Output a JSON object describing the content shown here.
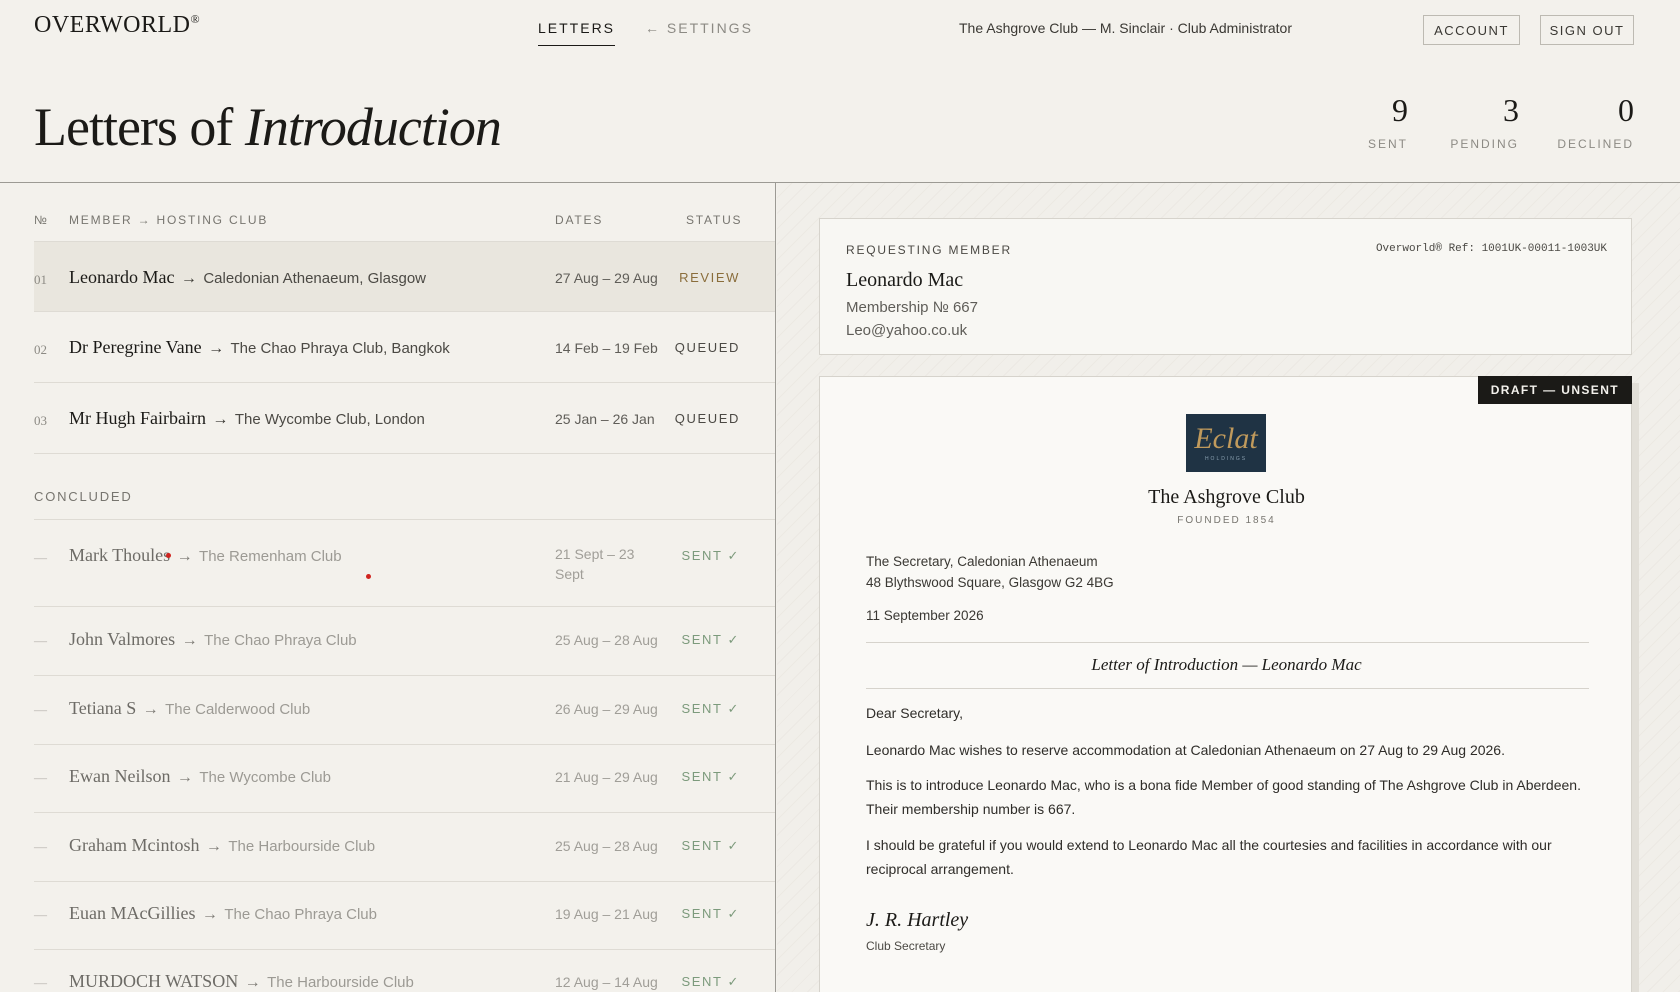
{
  "header": {
    "brand": "OVERWORLD",
    "brand_mark": "®",
    "nav": [
      {
        "label": "LETTERS"
      },
      {
        "label": "← SETTINGS"
      }
    ],
    "user": "The Ashgrove Club — M. Sinclair · Club Administrator",
    "account_label": "ACCOUNT",
    "signout_label": "SIGN OUT"
  },
  "title": {
    "plain": "Letters of ",
    "italic": "Introduction"
  },
  "stats": [
    {
      "num": "9",
      "label": "SENT"
    },
    {
      "num": "3",
      "label": "PENDING"
    },
    {
      "num": "0",
      "label": "DECLINED"
    }
  ],
  "list": {
    "headers": {
      "no": "№",
      "member": "MEMBER → HOSTING CLUB",
      "dates": "DATES",
      "status": "STATUS"
    },
    "pending": [
      {
        "no": "01",
        "name": "Leonardo Mac",
        "club": "Caledonian Athenaeum, Glasgow",
        "dates": "27 Aug – 29 Aug",
        "status": "REVIEW"
      },
      {
        "no": "02",
        "name": "Dr Peregrine Vane",
        "club": "The Chao Phraya Club, Bangkok",
        "dates": "14 Feb – 19 Feb",
        "status": "QUEUED"
      },
      {
        "no": "03",
        "name": "Mr Hugh Fairbairn",
        "club": "The Wycombe Club, London",
        "dates": "25 Jan – 26 Jan",
        "status": "QUEUED"
      }
    ],
    "concluded_label": "CONCLUDED",
    "concluded": [
      {
        "no": "—",
        "name": "Mark Thoules",
        "club": "The Remenham Club",
        "dates": "21 Sept – 23 Sept",
        "status": "SENT ✓"
      },
      {
        "no": "—",
        "name": "John Valmores",
        "club": "The Chao Phraya Club",
        "dates": "25 Aug – 28 Aug",
        "status": "SENT ✓"
      },
      {
        "no": "—",
        "name": "Tetiana S",
        "club": "The Calderwood Club",
        "dates": "26 Aug – 29 Aug",
        "status": "SENT ✓"
      },
      {
        "no": "—",
        "name": "Ewan Neilson",
        "club": "The Wycombe Club",
        "dates": "21 Aug – 29 Aug",
        "status": "SENT ✓"
      },
      {
        "no": "—",
        "name": "Graham Mcintosh",
        "club": "The Harbourside Club",
        "dates": "25 Aug – 28 Aug",
        "status": "SENT ✓"
      },
      {
        "no": "—",
        "name": "Euan MAcGillies",
        "club": "The Chao Phraya Club",
        "dates": "19 Aug – 21 Aug",
        "status": "SENT ✓"
      },
      {
        "no": "—",
        "name": "MURDOCH WATSON",
        "club": "The Harbourside Club",
        "dates": "12 Aug – 14 Aug",
        "status": "SENT ✓"
      }
    ]
  },
  "member": {
    "label": "REQUESTING MEMBER",
    "ref": "Overworld® Ref: 1001UK-00011-1003UK",
    "name": "Leonardo Mac",
    "membership": "Membership № 667",
    "email": "Leo@yahoo.co.uk"
  },
  "letter": {
    "badge": "DRAFT — UNSENT",
    "crest_script": "Eclat",
    "crest_sub": "HOLDINGS",
    "club_name": "The Ashgrove Club",
    "founded": "FOUNDED 1854",
    "addr_line1": "The Secretary, Caledonian Athenaeum",
    "addr_line2": "48 Blythswood Square, Glasgow G2 4BG",
    "date": "11 September 2026",
    "subject": "Letter of Introduction — Leonardo Mac",
    "salutation": "Dear Secretary,",
    "para1": "Leonardo Mac wishes to reserve accommodation at Caledonian Athenaeum on 27 Aug to 29 Aug 2026.",
    "para2": "This is to introduce Leonardo Mac, who is a bona fide Member of good standing of The Ashgrove Club in Aberdeen. Their membership number is 667.",
    "para3": "I should be grateful if you would extend to Leonardo Mac all the courtesies and facilities in accordance with our reciprocal arrangement.",
    "signature": "J. R. Hartley",
    "sig_title": "Club Secretary"
  },
  "colors": {
    "accent_review": "#8a6d3b",
    "sent_green": "#7c9a7c",
    "crest_bg": "#1f3344"
  }
}
